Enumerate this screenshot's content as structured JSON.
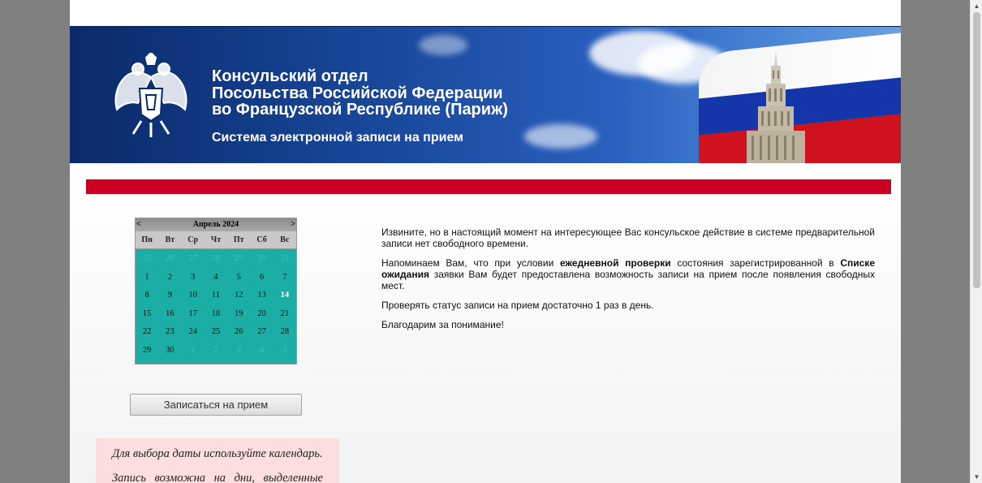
{
  "header": {
    "title_line1": "Консульский отдел",
    "title_line2": "Посольства Российской Федерации",
    "title_line3": "во Французской Республике (Париж)",
    "subtitle": "Система электронной записи на прием"
  },
  "calendar": {
    "month_label": "Апрель 2024",
    "prev": "<",
    "next": ">",
    "weekdays": [
      "Пн",
      "Вт",
      "Ср",
      "Чт",
      "Пт",
      "Сб",
      "Вс"
    ],
    "days": [
      [
        "25",
        "26",
        "27",
        "28",
        "29",
        "30",
        "31"
      ],
      [
        "1",
        "2",
        "3",
        "4",
        "5",
        "6",
        "7"
      ],
      [
        "8",
        "9",
        "10",
        "11",
        "12",
        "13",
        "14"
      ],
      [
        "15",
        "16",
        "17",
        "18",
        "19",
        "20",
        "21"
      ],
      [
        "22",
        "23",
        "24",
        "25",
        "26",
        "27",
        "28"
      ],
      [
        "29",
        "30",
        "1",
        "2",
        "3",
        "4",
        "5"
      ]
    ]
  },
  "book_button": "Записаться на прием",
  "hint": {
    "line1": "Для выбора даты используйте календарь.",
    "line2": "Запись возможна на дни, выделенные"
  },
  "message": {
    "p1": "Извините, но в настоящий момент на интересующее Вас консульское действие в системе предварительной записи нет свободного времени.",
    "p2_a": "Напоминаем Вам, что при условии ",
    "p2_b": "ежедневной проверки",
    "p2_c": " состояния зарегистрированной в ",
    "p2_d": "Списке ожидания",
    "p2_e": " заявки Вам будет предоставлена возможность записи на прием после появления свободных мест.",
    "p3": "Проверять статус записи на прием достаточно 1 раз в день.",
    "p4": "Благодарим за понимание!"
  },
  "colors": {
    "banner_blue": "#1a4a9e",
    "red_bar": "#cc0022",
    "calendar_teal": "#1aaea6",
    "hint_pink": "#fddede"
  }
}
